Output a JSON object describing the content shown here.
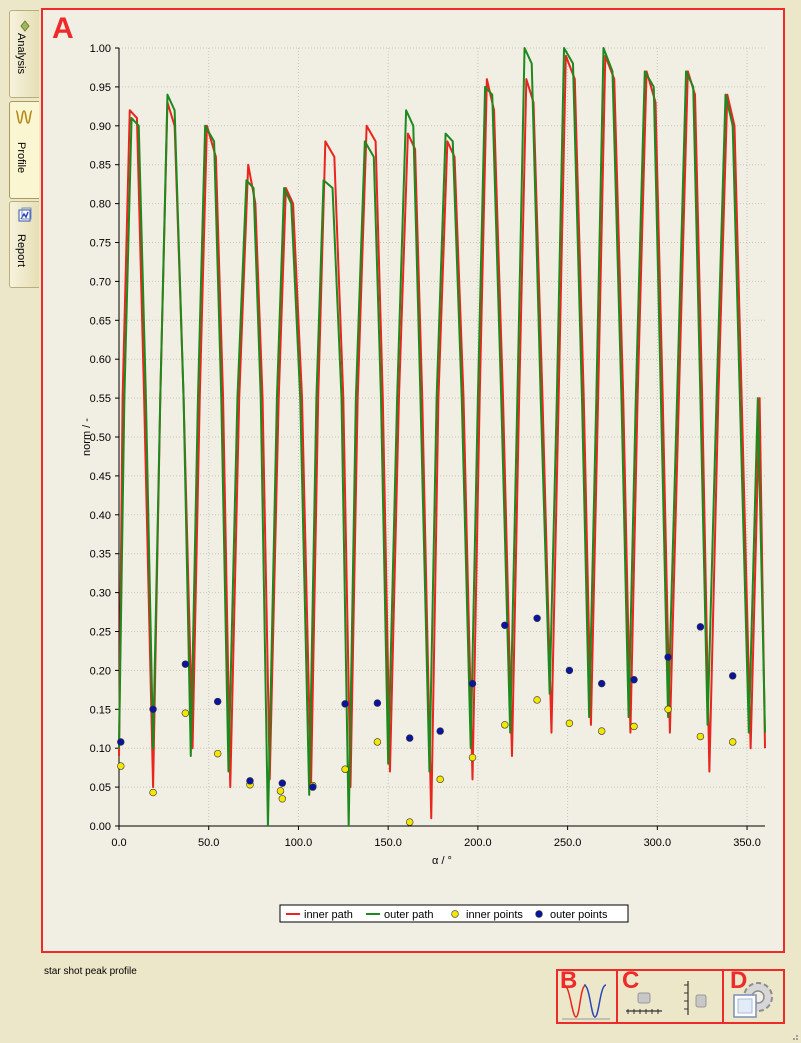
{
  "tabs": [
    {
      "label": "Analysis",
      "icon": "diamond-icon",
      "active": false
    },
    {
      "label": "Profile",
      "icon": "profile-wave-icon",
      "active": true
    },
    {
      "label": "Report",
      "icon": "report-icon",
      "active": false
    }
  ],
  "annotations": {
    "a": "A",
    "b": "B",
    "c": "C",
    "d": "D"
  },
  "status_text": "star shot peak profile",
  "toolbar": {
    "profile_icon": "profile-peaks-icon",
    "x_scale_icon": "horizontal-ruler-icon",
    "y_scale_icon": "vertical-ruler-icon",
    "settings_icon": "settings-gear-icon"
  },
  "colors": {
    "inner": "#e8261f",
    "outer": "#1d8a1d",
    "inner_points": "#f3e600",
    "outer_points": "#0a14a0",
    "annotation": "#ee2a2a"
  },
  "chart_data": {
    "type": "line",
    "xlabel": "α / °",
    "ylabel": "norm / -",
    "xlim": [
      0,
      360
    ],
    "ylim": [
      0,
      1.0
    ],
    "grid": true,
    "legend_position": "bottom-center",
    "x_ticks": [
      "0.0",
      "50.0",
      "100.0",
      "150.0",
      "200.0",
      "250.0",
      "300.0",
      "350.0"
    ],
    "y_ticks": [
      "0.00",
      "0.05",
      "0.10",
      "0.15",
      "0.20",
      "0.25",
      "0.30",
      "0.35",
      "0.40",
      "0.45",
      "0.50",
      "0.55",
      "0.60",
      "0.65",
      "0.70",
      "0.75",
      "0.80",
      "0.85",
      "0.90",
      "0.95",
      "1.00"
    ],
    "series": [
      {
        "name": "inner path",
        "style": "line",
        "x": [
          0,
          2,
          6,
          10,
          14,
          19,
          23,
          27,
          31,
          36,
          41,
          45,
          49,
          54,
          58,
          62,
          67,
          72,
          76,
          80,
          84,
          89,
          93,
          97,
          102,
          107,
          111,
          115,
          120,
          125,
          129,
          133,
          138,
          143,
          147,
          151,
          156,
          161,
          165,
          169,
          174,
          178,
          183,
          187,
          192,
          197,
          201,
          205,
          209,
          214,
          219,
          223,
          227,
          231,
          236,
          241,
          245,
          249,
          254,
          259,
          263,
          267,
          271,
          276,
          281,
          285,
          289,
          294,
          299,
          303,
          307,
          312,
          317,
          321,
          325,
          329,
          334,
          339,
          343,
          347,
          352,
          357,
          360
        ],
        "values": [
          0.09,
          0.55,
          0.92,
          0.91,
          0.55,
          0.05,
          0.55,
          0.93,
          0.9,
          0.55,
          0.1,
          0.55,
          0.9,
          0.86,
          0.55,
          0.05,
          0.55,
          0.85,
          0.8,
          0.55,
          0.06,
          0.55,
          0.82,
          0.8,
          0.55,
          0.05,
          0.55,
          0.88,
          0.86,
          0.55,
          0.05,
          0.55,
          0.9,
          0.88,
          0.55,
          0.07,
          0.55,
          0.89,
          0.87,
          0.55,
          0.01,
          0.55,
          0.88,
          0.86,
          0.55,
          0.06,
          0.55,
          0.96,
          0.92,
          0.55,
          0.09,
          0.55,
          0.96,
          0.93,
          0.55,
          0.12,
          0.55,
          0.99,
          0.96,
          0.55,
          0.13,
          0.55,
          0.99,
          0.96,
          0.55,
          0.12,
          0.55,
          0.97,
          0.93,
          0.55,
          0.12,
          0.55,
          0.97,
          0.94,
          0.55,
          0.07,
          0.55,
          0.94,
          0.9,
          0.55,
          0.1,
          0.55,
          0.1
        ]
      },
      {
        "name": "outer path",
        "style": "line",
        "x": [
          0,
          3,
          7,
          11,
          15,
          19,
          23,
          27,
          31,
          36,
          40,
          44,
          48,
          53,
          57,
          61,
          66,
          71,
          75,
          79,
          83,
          88,
          92,
          96,
          101,
          106,
          110,
          114,
          119,
          124,
          128,
          132,
          137,
          142,
          146,
          150,
          155,
          160,
          164,
          168,
          173,
          177,
          182,
          186,
          191,
          196,
          200,
          204,
          208,
          213,
          218,
          222,
          226,
          230,
          235,
          240,
          244,
          248,
          253,
          258,
          262,
          266,
          270,
          275,
          280,
          284,
          288,
          293,
          298,
          302,
          306,
          311,
          316,
          320,
          324,
          328,
          333,
          338,
          342,
          346,
          351,
          356,
          360
        ],
        "values": [
          0.1,
          0.55,
          0.91,
          0.9,
          0.55,
          0.1,
          0.55,
          0.94,
          0.92,
          0.55,
          0.09,
          0.55,
          0.9,
          0.88,
          0.55,
          0.07,
          0.55,
          0.83,
          0.82,
          0.55,
          0.0,
          0.55,
          0.82,
          0.8,
          0.55,
          0.04,
          0.55,
          0.83,
          0.82,
          0.55,
          0.0,
          0.55,
          0.88,
          0.86,
          0.55,
          0.08,
          0.55,
          0.92,
          0.9,
          0.55,
          0.07,
          0.55,
          0.89,
          0.88,
          0.55,
          0.1,
          0.55,
          0.95,
          0.94,
          0.55,
          0.12,
          0.55,
          1.0,
          0.98,
          0.55,
          0.17,
          0.55,
          1.0,
          0.98,
          0.55,
          0.14,
          0.55,
          1.0,
          0.97,
          0.55,
          0.14,
          0.55,
          0.97,
          0.95,
          0.55,
          0.14,
          0.55,
          0.97,
          0.95,
          0.55,
          0.13,
          0.55,
          0.94,
          0.9,
          0.55,
          0.12,
          0.55,
          0.12
        ]
      },
      {
        "name": "inner points",
        "style": "points",
        "x": [
          1,
          19,
          37,
          55,
          73,
          90,
          91,
          108,
          126,
          144,
          162,
          179,
          197,
          215,
          233,
          251,
          269,
          287,
          306,
          324,
          342
        ],
        "values": [
          0.077,
          0.043,
          0.145,
          0.093,
          0.053,
          0.045,
          0.035,
          0.052,
          0.073,
          0.108,
          0.005,
          0.06,
          0.088,
          0.13,
          0.162,
          0.132,
          0.122,
          0.128,
          0.15,
          0.115,
          0.108
        ]
      },
      {
        "name": "outer points",
        "style": "points",
        "x": [
          1,
          19,
          37,
          55,
          73,
          91,
          108,
          126,
          144,
          162,
          179,
          197,
          215,
          233,
          251,
          269,
          287,
          306,
          324,
          342
        ],
        "values": [
          0.108,
          0.15,
          0.208,
          0.16,
          0.058,
          0.055,
          0.05,
          0.157,
          0.158,
          0.113,
          0.122,
          0.183,
          0.258,
          0.267,
          0.2,
          0.183,
          0.188,
          0.217,
          0.256,
          0.193
        ]
      }
    ]
  }
}
